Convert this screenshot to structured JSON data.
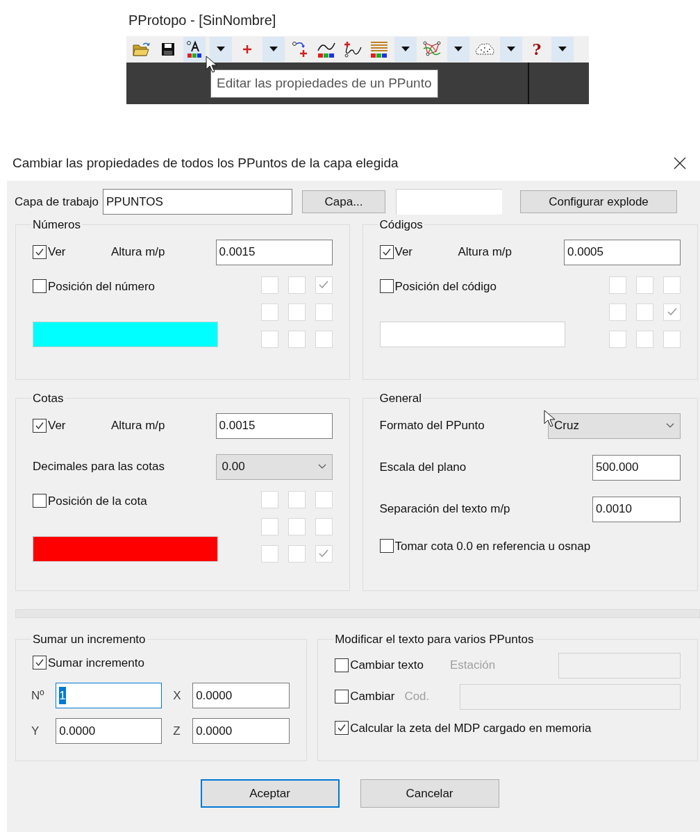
{
  "app_title": "PProtopo - [SinNombre]",
  "toolbar": {
    "buttons": [
      {
        "kind": "tool",
        "highlighted": false
      },
      {
        "kind": "tool",
        "highlighted": false
      },
      {
        "kind": "tool",
        "highlighted": true
      },
      {
        "kind": "dropdown",
        "highlighted": true
      },
      {
        "kind": "tool",
        "highlighted": false
      },
      {
        "kind": "dropdown",
        "highlighted": true
      },
      {
        "kind": "tool",
        "highlighted": false
      },
      {
        "kind": "tool",
        "highlighted": false
      },
      {
        "kind": "tool",
        "highlighted": false
      },
      {
        "kind": "tool",
        "highlighted": false
      },
      {
        "kind": "dropdown",
        "highlighted": true
      },
      {
        "kind": "tool",
        "highlighted": false
      },
      {
        "kind": "dropdown",
        "highlighted": true
      },
      {
        "kind": "tool",
        "highlighted": false
      },
      {
        "kind": "dropdown",
        "highlighted": true
      },
      {
        "kind": "help",
        "label": "?",
        "highlighted": false
      },
      {
        "kind": "dropdown",
        "highlighted": true
      }
    ],
    "tooltip": "Editar las propiedades de un PPunto"
  },
  "dialog": {
    "title": "Cambiar las propiedades de todos los PPuntos de la capa elegida",
    "layer": {
      "label": "Capa de trabajo",
      "value": "PPUNTOS",
      "button": "Capa...",
      "explode_button": "Configurar explode"
    },
    "numbers": {
      "title": "Números",
      "show": {
        "label": "Ver",
        "checked": true
      },
      "height": {
        "label": "Altura m/p",
        "value": "0.0015"
      },
      "position": {
        "label": "Posición del número",
        "checked": false
      },
      "anchor": [
        {
          "checked": false
        },
        {
          "checked": false
        },
        {
          "checked": true
        },
        {
          "checked": false
        },
        {
          "checked": false
        },
        {
          "checked": false
        },
        {
          "checked": false
        },
        {
          "checked": false
        },
        {
          "checked": false
        }
      ],
      "color": "#00ffff"
    },
    "codes": {
      "title": "Códigos",
      "show": {
        "label": "Ver",
        "checked": true
      },
      "height": {
        "label": "Altura m/p",
        "value": "0.0005"
      },
      "position": {
        "label": "Posición del código",
        "checked": false
      },
      "anchor": [
        {
          "checked": false
        },
        {
          "checked": false
        },
        {
          "checked": false
        },
        {
          "checked": false
        },
        {
          "checked": false
        },
        {
          "checked": true
        },
        {
          "checked": false
        },
        {
          "checked": false
        },
        {
          "checked": false
        }
      ],
      "color": "#ffffff"
    },
    "dims": {
      "title": "Cotas",
      "show": {
        "label": "Ver",
        "checked": true
      },
      "height": {
        "label": "Altura m/p",
        "value": "0.0015"
      },
      "decimals": {
        "label": "Decimales para las cotas",
        "value": "0.00"
      },
      "position": {
        "label": "Posición de la cota",
        "checked": false
      },
      "anchor": [
        {
          "checked": false
        },
        {
          "checked": false
        },
        {
          "checked": false
        },
        {
          "checked": false
        },
        {
          "checked": false
        },
        {
          "checked": false
        },
        {
          "checked": false
        },
        {
          "checked": false
        },
        {
          "checked": true
        }
      ],
      "color": "#ff0000"
    },
    "general": {
      "title": "General",
      "format": {
        "label": "Formato del PPunto",
        "value": "Cruz"
      },
      "scale": {
        "label": "Escala del plano",
        "value": "500.000"
      },
      "separation": {
        "label": "Separación del texto m/p",
        "value": "0.0010"
      },
      "reference": {
        "label": "Tomar cota 0.0 en referencia u osnap",
        "checked": false
      }
    },
    "progress": {
      "level": 0
    },
    "increment": {
      "title": "Sumar un incremento",
      "add": {
        "label": "Sumar incremento",
        "checked": true
      },
      "fields": [
        {
          "label": "Nº",
          "value": "1",
          "focused": true
        },
        {
          "label": "X",
          "value": "0.0000",
          "focused": false
        },
        {
          "label": "Y",
          "value": "0.0000",
          "focused": false
        },
        {
          "label": "Z",
          "value": "0.0000",
          "focused": false
        }
      ]
    },
    "modify": {
      "title": "Modificar el texto para varios PPuntos",
      "rows": [
        {
          "label": "Cambiar texto",
          "checked": false,
          "field_label": "Estación",
          "disabled": true
        },
        {
          "label": "Cambiar",
          "checked": false,
          "field_label": "Cod.",
          "disabled": true
        }
      ],
      "calc": {
        "label": "Calcular la zeta del MDP cargado en memoria",
        "checked": true
      }
    },
    "buttons": [
      {
        "label": "Aceptar",
        "default": true
      },
      {
        "label": "Cancelar",
        "default": false
      }
    ]
  }
}
